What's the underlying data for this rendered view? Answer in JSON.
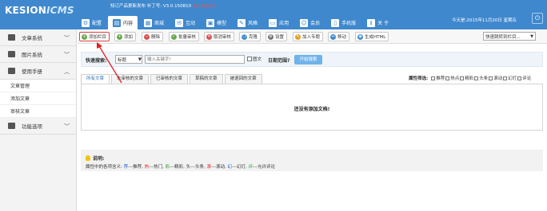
{
  "header": {
    "logo_main": "KESION",
    "logo_sub": "ICMS",
    "version_note": "知订产品更新发布  补丁号: V3.0.150810",
    "version_date": "2015/8/10",
    "date_text": "今天是:2015年11月20日 星期五",
    "exit_icon_glyph": "⏻"
  },
  "nav_tabs": [
    {
      "label": "配置",
      "icon": "gear-icon",
      "glyph": "⚙",
      "active": false
    },
    {
      "label": "内容",
      "icon": "document-icon",
      "glyph": "▤",
      "active": true
    },
    {
      "label": "商城",
      "icon": "shop-icon",
      "glyph": "▦",
      "active": false
    },
    {
      "label": "互动",
      "icon": "chat-icon",
      "glyph": "✉",
      "active": false
    },
    {
      "label": "模型",
      "icon": "model-icon",
      "glyph": "▣",
      "active": false
    },
    {
      "label": "风格",
      "icon": "style-icon",
      "glyph": "✎",
      "active": false
    },
    {
      "label": "应用",
      "icon": "app-icon",
      "glyph": "▭",
      "active": false
    },
    {
      "label": "会员",
      "icon": "member-icon",
      "glyph": "☺",
      "active": false
    },
    {
      "label": "手机版",
      "icon": "mobile-icon",
      "glyph": "▯",
      "active": false
    },
    {
      "label": "关 于",
      "icon": "about-icon",
      "glyph": "ℹ",
      "active": false
    }
  ],
  "sidebar": {
    "groups": [
      {
        "label": "文章系统",
        "icon": "article-icon"
      },
      {
        "label": "图片系统",
        "icon": "picture-icon"
      },
      {
        "label": "使用手册",
        "icon": "manual-icon"
      }
    ],
    "items": [
      "文章管理",
      "添加文章",
      "审核文章"
    ],
    "extra_group": {
      "label": "功能选项",
      "icon": "options-icon"
    }
  },
  "toolbar": {
    "buttons": [
      {
        "label": "添加栏目",
        "icon": "plus-icon",
        "glyph": "+"
      },
      {
        "label": "添加",
        "icon": "add-icon",
        "glyph": "+"
      },
      {
        "label": "删除",
        "icon": "delete-icon",
        "glyph": "−"
      },
      {
        "label": "批量审核",
        "icon": "batch-audit-icon",
        "glyph": "✓"
      },
      {
        "label": "取消审核",
        "icon": "cancel-audit-icon",
        "glyph": "✕"
      },
      {
        "label": "克隆",
        "icon": "clone-icon",
        "glyph": "❐"
      },
      {
        "label": "设置",
        "icon": "settings-icon",
        "glyph": "⚙"
      },
      {
        "label": "加入专题",
        "icon": "topic-icon",
        "glyph": "✎"
      },
      {
        "label": "移动",
        "icon": "move-icon",
        "glyph": "↔"
      },
      {
        "label": "生成HTML",
        "icon": "html-icon",
        "glyph": "◉"
      }
    ],
    "quick_jump": "快速跳转到栏目...",
    "quick_jump_arrow": "▼"
  },
  "search": {
    "label": "快速搜索:",
    "field_select": "标题",
    "select_arrow": "▼",
    "placeholder": "输入关键字!",
    "image_checkbox": "图文",
    "date_range_label": "日期范围?",
    "button": "开始搜索"
  },
  "content_tabs": [
    "所有文章",
    "未审核的文章",
    "已审核的文章",
    "草稿的文章",
    "被退回的文章"
  ],
  "attr_filter": {
    "label": "属性筛选:",
    "options": [
      "推荐",
      "热点",
      "精彩",
      "头条",
      "滚动",
      "幻灯",
      "评论"
    ]
  },
  "empty_message": "还没有添加文档!",
  "notes": {
    "title": "说明:",
    "prefix": "属性中的各项含义:",
    "entries": [
      {
        "key": "荐",
        "desc": "---推荐",
        "color": "#1a5fd6"
      },
      {
        "key": "热",
        "desc": "---热门",
        "color": "#e02020"
      },
      {
        "key": "彩",
        "desc": "---精彩",
        "color": "#2a9a2a"
      },
      {
        "key": "头",
        "desc": "---头条",
        "color": "#333333"
      },
      {
        "key": "滚",
        "desc": "---滚动",
        "color": "#e02020"
      },
      {
        "key": "幻",
        "desc": "---幻灯",
        "color": "#1a5fd6"
      },
      {
        "key": "评",
        "desc": "---允许评论",
        "color": "#2a9a2a"
      }
    ]
  },
  "colors": {
    "header_blue": "#3f88cd",
    "search_button": "#70b3ea",
    "annotation_red": "#e02020"
  }
}
